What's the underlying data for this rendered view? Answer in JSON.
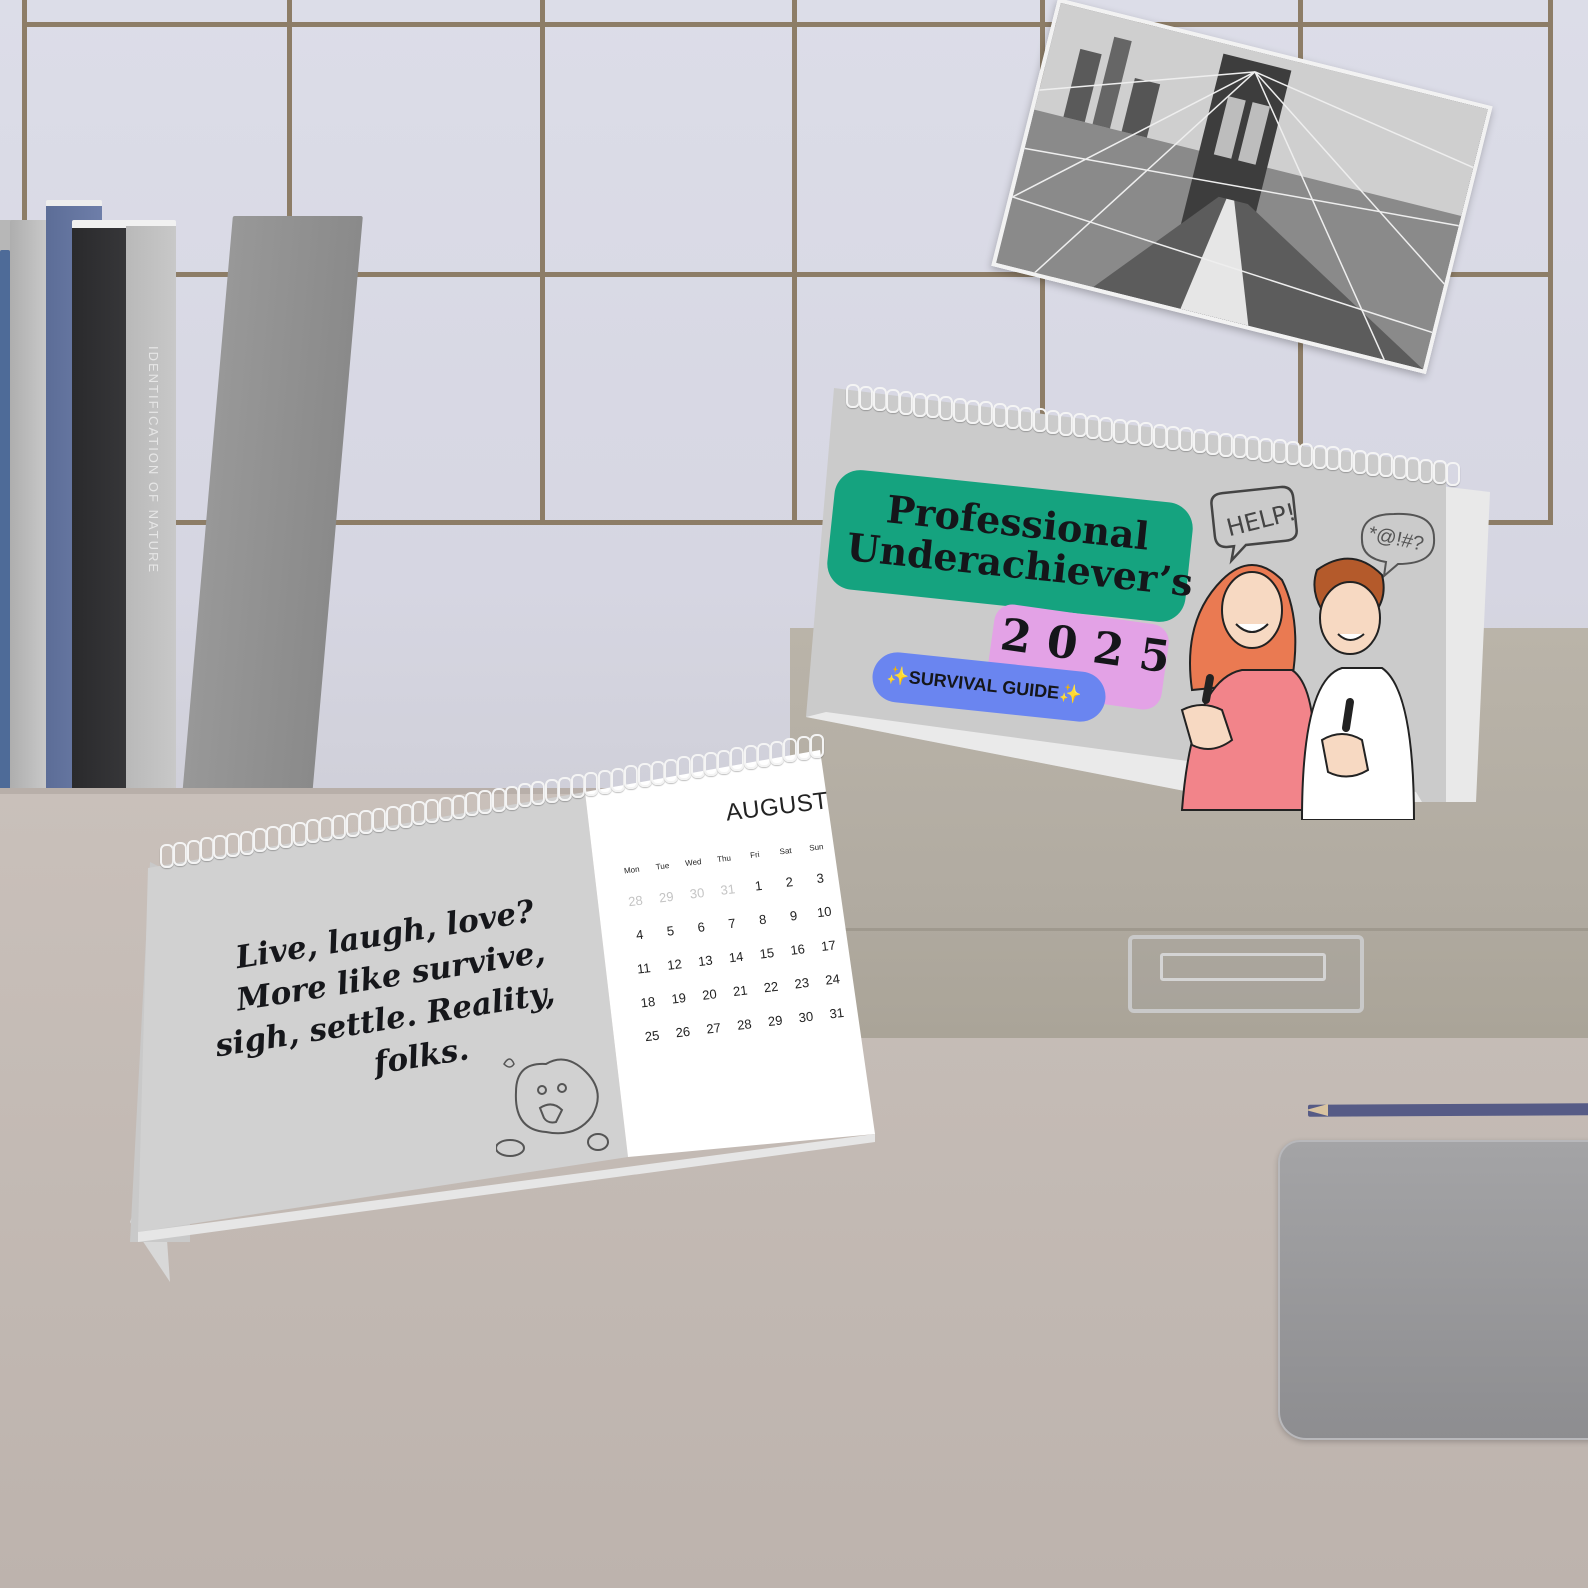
{
  "books": {
    "spine_text": "IDENTIFICATION OF NATURE"
  },
  "cover_calendar": {
    "title_line1": "Professional",
    "title_line2": "Underachiever’s",
    "year": "2025",
    "subtitle": "✨SURVIVAL GUIDE✨",
    "speech_bubble": "HELP!",
    "symbol_bubble": "*@!#?",
    "colors": {
      "title_bg": "#15a37f",
      "year_bg": "#e3a2e6",
      "subtitle_bg": "#6a85f0",
      "page_bg": "#cbcbcb"
    }
  },
  "month_calendar": {
    "quote_lines": [
      "Live, laugh, love?",
      "More like survive,",
      "sigh, settle. Reality,",
      "folks."
    ],
    "month": "AUGUST",
    "weekdays": [
      "Mon",
      "Tue",
      "Wed",
      "Thu",
      "Fri",
      "Sat",
      "Sun"
    ],
    "weeks": [
      [
        "28",
        "29",
        "30",
        "31",
        "1",
        "2",
        "3"
      ],
      [
        "4",
        "5",
        "6",
        "7",
        "8",
        "9",
        "10"
      ],
      [
        "11",
        "12",
        "13",
        "14",
        "15",
        "16",
        "17"
      ],
      [
        "18",
        "19",
        "20",
        "21",
        "22",
        "23",
        "24"
      ],
      [
        "25",
        "26",
        "27",
        "28",
        "29",
        "30",
        "31"
      ]
    ],
    "faded_days_count": 4
  }
}
